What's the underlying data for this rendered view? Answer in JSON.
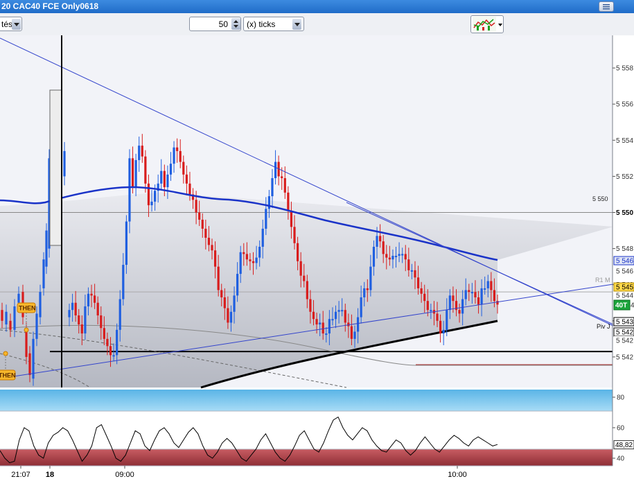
{
  "window": {
    "title": "20  CAC40 FCE Only0618"
  },
  "toolbar": {
    "left_select": "tés",
    "bar_count": "50",
    "bar_unit": "(x) ticks"
  },
  "price_axis": {
    "ticks": [
      "5 558",
      "5 556",
      "5 554",
      "5 552",
      "5 550",
      "5 548",
      "5 546",
      "5 544",
      "5 542"
    ],
    "level_5550": "5 550",
    "r1_label": "R1 M",
    "piv_label": "Piv J",
    "then_label": "THEN",
    "mini_labels": [
      "5 546",
      "5 546",
      "5 544",
      "5 543",
      "5 542",
      "5 542"
    ],
    "badge_highlight": "5 545",
    "badge_green": "40T",
    "badge_green_suffix": "4"
  },
  "osc_axis": {
    "ticks": [
      "80",
      "60",
      "40"
    ],
    "value": "48,82"
  },
  "time_axis": {
    "labels": [
      "21:07",
      "18",
      "09:00",
      "10:00"
    ]
  },
  "colors": {
    "up": "#1f5fe0",
    "down": "#d81c1c",
    "ma": "#1a33c8",
    "trend": "#3344cc",
    "title_bar": "#2a78d6",
    "osc_top": "#7ec8ec",
    "osc_bottom": "#a84a52"
  },
  "chart_data": {
    "type": "candlestick",
    "instrument": "CAC40 FCE",
    "y_axis": {
      "min": 5540.5,
      "max": 5559.5
    },
    "closes": [
      5544.6,
      5545.0,
      5544.3,
      5543.8,
      5543.3,
      5544.8,
      5545.5,
      5545.4,
      5545.0,
      5544.3,
      5543.6,
      5543.0,
      5542.6,
      5542.1,
      5542.1,
      5543.5,
      5545.2,
      5547.1,
      5549.5,
      5553.0,
      5551.4,
      5552.9,
      5553.7,
      5553.1,
      5551.6,
      5550.4,
      5550.6,
      5551.2,
      5551.6,
      5552.3,
      5551.4,
      5552.1,
      5552.7,
      5553.6,
      5553.4,
      5552.8,
      5552.1,
      5551.6,
      5551.0,
      5550.7,
      5550.0,
      5549.6,
      5549.1,
      5548.6,
      5548.2,
      5547.9,
      5547.0,
      5545.7,
      5545.3,
      5544.7,
      5543.9,
      5544.5,
      5545.4,
      5546.6,
      5547.8,
      5547.7,
      5547.4,
      5547.3,
      5547.2,
      5547.5,
      5548.1,
      5549.1,
      5550.2,
      5550.9,
      5551.9,
      5552.8,
      5552.0,
      5551.9,
      5551.1,
      5550.1,
      5549.2,
      5548.3,
      5547.3,
      5546.5,
      5546.2,
      5545.2,
      5544.5,
      5544.1,
      5543.8,
      5543.9,
      5543.3,
      5543.3,
      5544.1,
      5544.1,
      5544.5,
      5544.6,
      5544.6,
      5543.9,
      5543.7,
      5543.0,
      5543.4,
      5544.2,
      5545.3,
      5545.8,
      5545.7,
      5547.0,
      5548.1,
      5548.7,
      5548.4,
      5547.7,
      5547.5,
      5547.4,
      5547.6,
      5547.6,
      5547.7,
      5547.7,
      5547.4,
      5546.8,
      5546.8,
      5546.4,
      5545.8,
      5545.5,
      5545.1,
      5544.6,
      5544.6,
      5544.4,
      5544.0,
      5543.3,
      5543.5,
      5544.6,
      5545.4,
      5545.1,
      5544.6,
      5544.4,
      5545.2,
      5545.7,
      5545.6,
      5545.6,
      5545.3,
      5544.9,
      5545.8,
      5545.8,
      5546.2,
      5545.7,
      5545.1,
      5544.9
    ],
    "moving_average_last": 5546.3,
    "moving_average_peak": 5551.2,
    "level_r1": 5545.6,
    "level_pivot": 5542.3,
    "level_5550": 5550.0,
    "oscillator": {
      "ylim": [
        35,
        85
      ],
      "last": 48.82,
      "upper_band": 70,
      "lower_band": 32
    }
  }
}
